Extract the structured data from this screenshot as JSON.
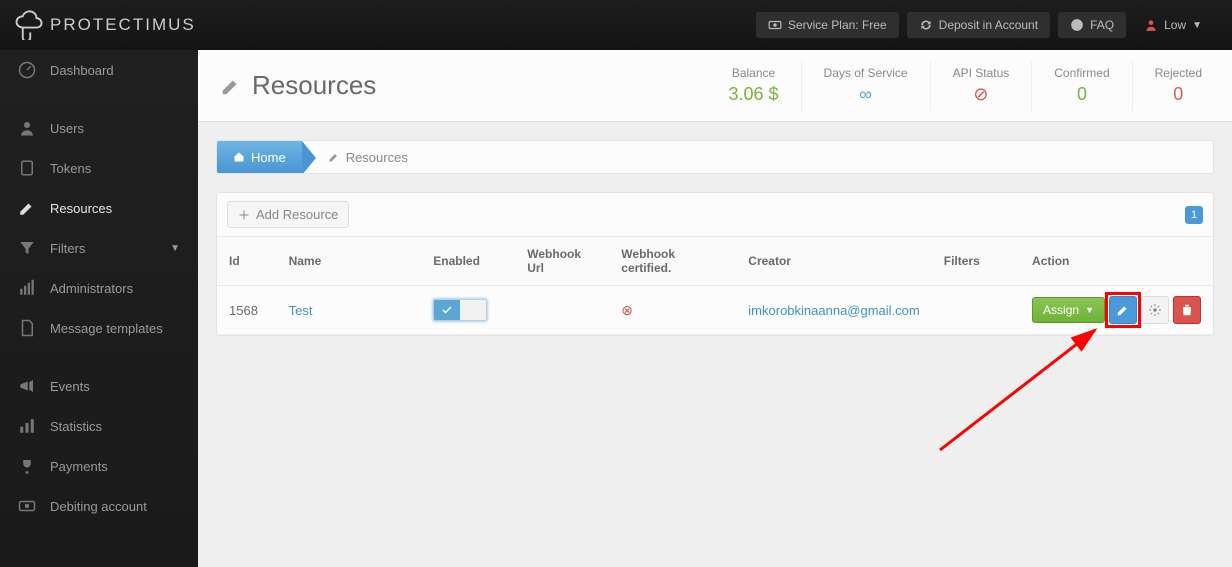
{
  "brand": "PROTECTIMUS",
  "topbar": {
    "service_plan": "Service Plan: Free",
    "deposit": "Deposit in Account",
    "faq": "FAQ",
    "user": "Low"
  },
  "sidebar": {
    "items": [
      {
        "label": "Dashboard"
      },
      {
        "label": "Users"
      },
      {
        "label": "Tokens"
      },
      {
        "label": "Resources"
      },
      {
        "label": "Filters"
      },
      {
        "label": "Administrators"
      },
      {
        "label": "Message templates"
      },
      {
        "label": "Events"
      },
      {
        "label": "Statistics"
      },
      {
        "label": "Payments"
      },
      {
        "label": "Debiting account"
      }
    ]
  },
  "page": {
    "title": "Resources",
    "stats": {
      "balance": {
        "label": "Balance",
        "value": "3.06 $"
      },
      "days": {
        "label": "Days of Service",
        "value": "∞"
      },
      "api": {
        "label": "API Status"
      },
      "confirmed": {
        "label": "Confirmed",
        "value": "0"
      },
      "rejected": {
        "label": "Rejected",
        "value": "0"
      }
    }
  },
  "breadcrumbs": {
    "home": "Home",
    "current": "Resources"
  },
  "toolbar": {
    "add": "Add Resource",
    "page": "1"
  },
  "table": {
    "cols": {
      "id": "Id",
      "name": "Name",
      "enabled": "Enabled",
      "webhook": "Webhook Url",
      "certified": "Webhook certified.",
      "creator": "Creator",
      "filters": "Filters",
      "action": "Action"
    },
    "rows": [
      {
        "id": "1568",
        "name": "Test",
        "creator": "imkorobkinaanna@gmail.com",
        "assign": "Assign"
      }
    ]
  }
}
